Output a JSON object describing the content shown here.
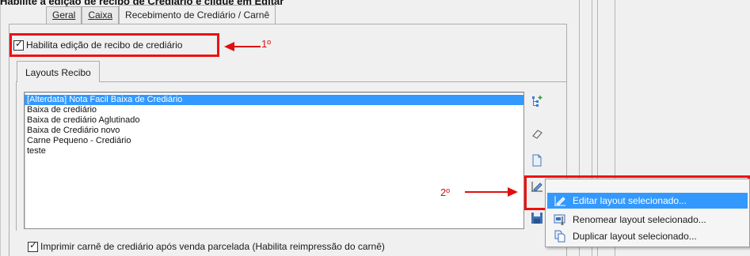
{
  "caption": "Habilite a edição de recibo de Crediário e clique em Editar",
  "tabs": [
    {
      "label": "Geral",
      "accel": "G",
      "active": false
    },
    {
      "label": "Caixa",
      "accel": "C",
      "active": false
    },
    {
      "label": "Recebimento de Crediário / Carnê",
      "accel": "R",
      "active": true
    }
  ],
  "enable_edit_checkbox": {
    "label": "Habilita edição de recibo de crediário",
    "checked": true
  },
  "annotation_1": "1º",
  "annotation_2": "2º",
  "inner_tab": {
    "label": "Layouts Recibo",
    "accel": "L"
  },
  "layouts": [
    {
      "label": "[Alterdata] Nota Facil Baixa de Crediário",
      "selected": true
    },
    {
      "label": "Baixa de crediário",
      "selected": false
    },
    {
      "label": "Baixa de crediário Aglutinado",
      "selected": false
    },
    {
      "label": "Baixa de Crediário novo",
      "selected": false
    },
    {
      "label": "Carne Pequeno - Crediário",
      "selected": false
    },
    {
      "label": "teste",
      "selected": false
    }
  ],
  "side_icons": [
    "add-tree-icon",
    "eraser-icon",
    "new-document-icon",
    "edit-layout-icon",
    "save-icon"
  ],
  "context_menu": {
    "items": [
      {
        "label": "Editar layout selecionado...",
        "icon": "edit-layout-icon",
        "highlight": true
      },
      {
        "label": "Renomear layout selecionado...",
        "icon": "rename-icon",
        "highlight": false
      },
      {
        "label": "Duplicar layout selecionado...",
        "icon": "duplicate-icon",
        "highlight": false
      }
    ]
  },
  "print_checkbox": {
    "label": "Imprimir carnê de crediário após venda parcelada (Habilita reimpressão do carnê)",
    "checked": true
  },
  "colors": {
    "annotation_red": "#ee1111",
    "selection_blue": "#3399ff"
  }
}
